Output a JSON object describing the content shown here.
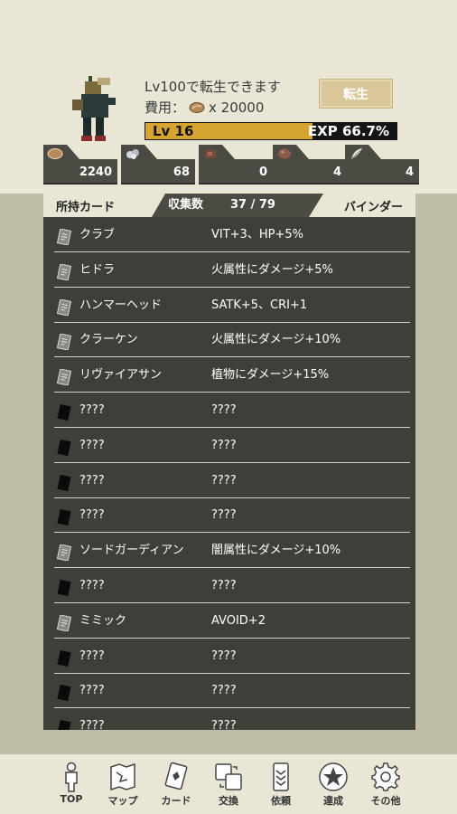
{
  "header": {
    "rebirth_text": "Lv100で転生できます",
    "cost_label": "費用：",
    "cost_value": "x 20000",
    "rebirth_button": "転生",
    "level": "Lv 16",
    "exp": "EXP 66.7%",
    "exp_fraction": 0.667
  },
  "resources": [
    {
      "icon": "seed-icon",
      "value": "2240"
    },
    {
      "icon": "ore-icon",
      "value": "68"
    },
    {
      "icon": "meat-icon",
      "value": "0"
    },
    {
      "icon": "egg-icon",
      "value": "4"
    },
    {
      "icon": "feather-icon",
      "value": "4"
    }
  ],
  "tabs": {
    "owned": "所持カード",
    "collection_label": "収集数",
    "collection_count": "37 / 79",
    "binder": "バインダー"
  },
  "cards": [
    {
      "name": "クラブ",
      "effect": "VIT+3、HP+5%",
      "known": true
    },
    {
      "name": "ヒドラ",
      "effect": "火属性にダメージ+5%",
      "known": true
    },
    {
      "name": "ハンマーヘッド",
      "effect": "SATK+5、CRI+1",
      "known": true
    },
    {
      "name": "クラーケン",
      "effect": "火属性にダメージ+10%",
      "known": true
    },
    {
      "name": "リヴァイアサン",
      "effect": "植物にダメージ+15%",
      "known": true
    },
    {
      "name": "????",
      "effect": "????",
      "known": false
    },
    {
      "name": "????",
      "effect": "????",
      "known": false
    },
    {
      "name": "????",
      "effect": "????",
      "known": false
    },
    {
      "name": "????",
      "effect": "????",
      "known": false
    },
    {
      "name": "ソードガーディアン",
      "effect": "闇属性にダメージ+10%",
      "known": true
    },
    {
      "name": "????",
      "effect": "????",
      "known": false
    },
    {
      "name": "ミミック",
      "effect": "AVOID+2",
      "known": true
    },
    {
      "name": "????",
      "effect": "????",
      "known": false
    },
    {
      "name": "????",
      "effect": "????",
      "known": false
    },
    {
      "name": "????",
      "effect": "????",
      "known": false
    }
  ],
  "nav": [
    {
      "label": "TOP",
      "icon": "person-icon"
    },
    {
      "label": "マップ",
      "icon": "map-icon"
    },
    {
      "label": "カード",
      "icon": "card-icon"
    },
    {
      "label": "交換",
      "icon": "exchange-icon"
    },
    {
      "label": "依頼",
      "icon": "rank-icon"
    },
    {
      "label": "達成",
      "icon": "star-icon"
    },
    {
      "label": "その他",
      "icon": "gear-icon"
    }
  ]
}
